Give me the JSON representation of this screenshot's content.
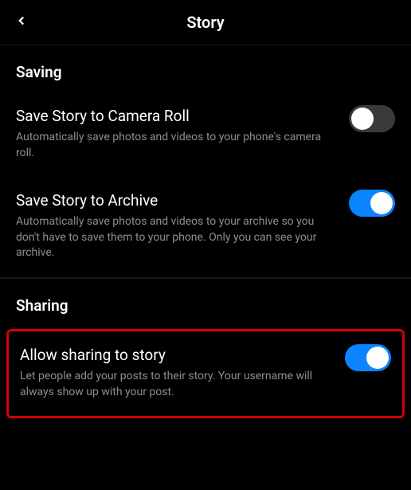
{
  "header": {
    "title": "Story"
  },
  "sections": {
    "saving": {
      "header": "Saving",
      "items": {
        "cameraRoll": {
          "title": "Save Story to Camera Roll",
          "description": "Automatically save photos and videos to your phone's camera roll.",
          "enabled": false
        },
        "archive": {
          "title": "Save Story to Archive",
          "description": "Automatically save photos and videos to your archive so you don't have to save them to your phone. Only you can see your archive.",
          "enabled": true
        }
      }
    },
    "sharing": {
      "header": "Sharing",
      "items": {
        "allowSharing": {
          "title": "Allow sharing to story",
          "description": "Let people add your posts to their story. Your username will always show up with your post.",
          "enabled": true
        }
      }
    }
  }
}
